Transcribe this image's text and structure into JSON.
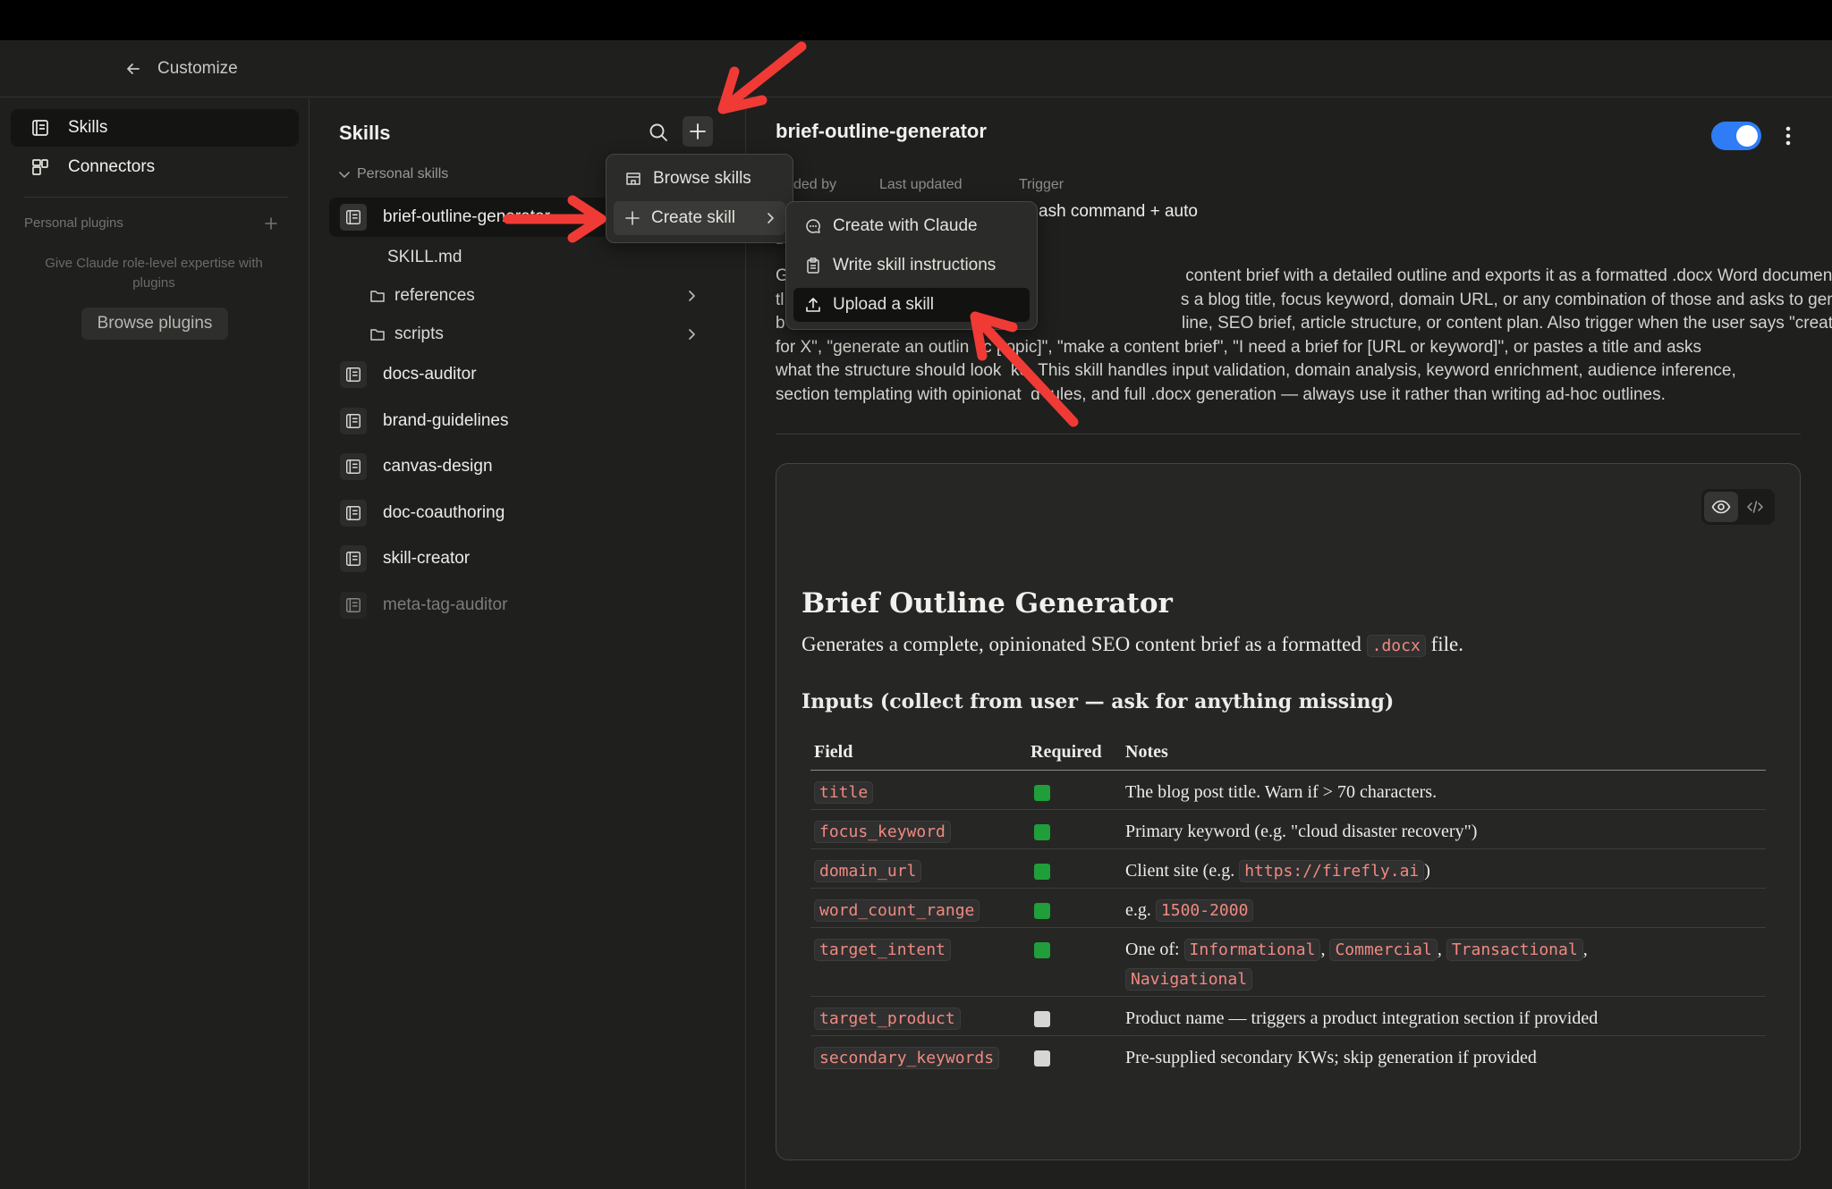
{
  "header": {
    "back_label": "Customize"
  },
  "sidebar": {
    "nav": [
      {
        "label": "Skills"
      },
      {
        "label": "Connectors"
      }
    ],
    "personal_plugins": {
      "title": "Personal plugins",
      "empty_text": "Give Claude role-level expertise with plugins",
      "browse_label": "Browse plugins"
    }
  },
  "skills_panel": {
    "title": "Skills",
    "group_label": "Personal skills",
    "items": [
      {
        "name": "brief-outline-generator"
      },
      {
        "name": "docs-auditor"
      },
      {
        "name": "brand-guidelines"
      },
      {
        "name": "canvas-design"
      },
      {
        "name": "doc-coauthoring"
      },
      {
        "name": "skill-creator"
      },
      {
        "name": "meta-tag-auditor"
      }
    ],
    "sub_items": [
      {
        "name": "SKILL.md"
      },
      {
        "name": "references"
      },
      {
        "name": "scripts"
      }
    ]
  },
  "add_menu": {
    "items": [
      {
        "label": "Browse skills"
      },
      {
        "label": "Create skill"
      }
    ],
    "submenu": [
      {
        "label": "Create with Claude"
      },
      {
        "label": "Write skill instructions"
      },
      {
        "label": "Upload a skill"
      }
    ]
  },
  "detail": {
    "title": "brief-outline-generator",
    "enabled": true,
    "meta": {
      "added_by_label": "ded by",
      "updated_label": "Last updated",
      "trigger_label": "Trigger",
      "trigger_value": "ash command + auto"
    },
    "description_label": "D",
    "description_lines": [
      "G                                                                                    content brief with a detailed outline and exports it as a formatted .docx Word document. Use",
      "tl                                                                                    s a blog title, focus keyword, domain URL, or any combination of those and asks to generate a",
      "b                                                                                    line, SEO brief, article structure, or content plan. Also trigger when the user says \"create a brief",
      "for X\", \"generate an outlin  fc [topic]\", \"make a content brief\", \"I need a brief for [URL or keyword]\", or pastes a title and asks",
      "what the structure should look  ke. This skill handles input validation, domain analysis, keyword enrichment, audience inference,",
      "section templating with opinionat  d rules, and full .docx generation — always use it rather than writing ad-hoc outlines."
    ]
  },
  "document": {
    "heading": "Brief Outline Generator",
    "lead_before": "Generates a complete, opinionated SEO content brief as a formatted",
    "lead_code": ".docx",
    "lead_after": "file.",
    "inputs_heading": "Inputs (collect from user — ask for anything missing)",
    "columns": [
      "Field",
      "Required",
      "Notes"
    ],
    "rows": [
      {
        "field": "title",
        "required": true,
        "notes": "The blog post title. Warn if > 70 characters."
      },
      {
        "field": "focus_keyword",
        "required": true,
        "notes": "Primary keyword (e.g. \"cloud disaster recovery\")"
      },
      {
        "field": "domain_url",
        "required": true,
        "notes_before": "Client site (e.g.",
        "notes_code": "https://firefly.ai",
        "notes_after": ")"
      },
      {
        "field": "word_count_range",
        "required": true,
        "notes_before": "e.g.",
        "notes_code": "1500-2000"
      },
      {
        "field": "target_intent",
        "required": true,
        "notes_before": "One of:",
        "options": [
          "Informational",
          "Commercial",
          "Transactional",
          "Navigational"
        ]
      },
      {
        "field": "target_product",
        "required": false,
        "notes": "Product name — triggers a product integration section if provided"
      },
      {
        "field": "secondary_keywords",
        "required": false,
        "notes": "Pre-supplied secondary KWs; skip generation if provided"
      }
    ]
  },
  "colors": {
    "accent_toggle": "#2e7cf6",
    "annotation_arrow": "#f03a35",
    "code_text": "#f08a80"
  }
}
